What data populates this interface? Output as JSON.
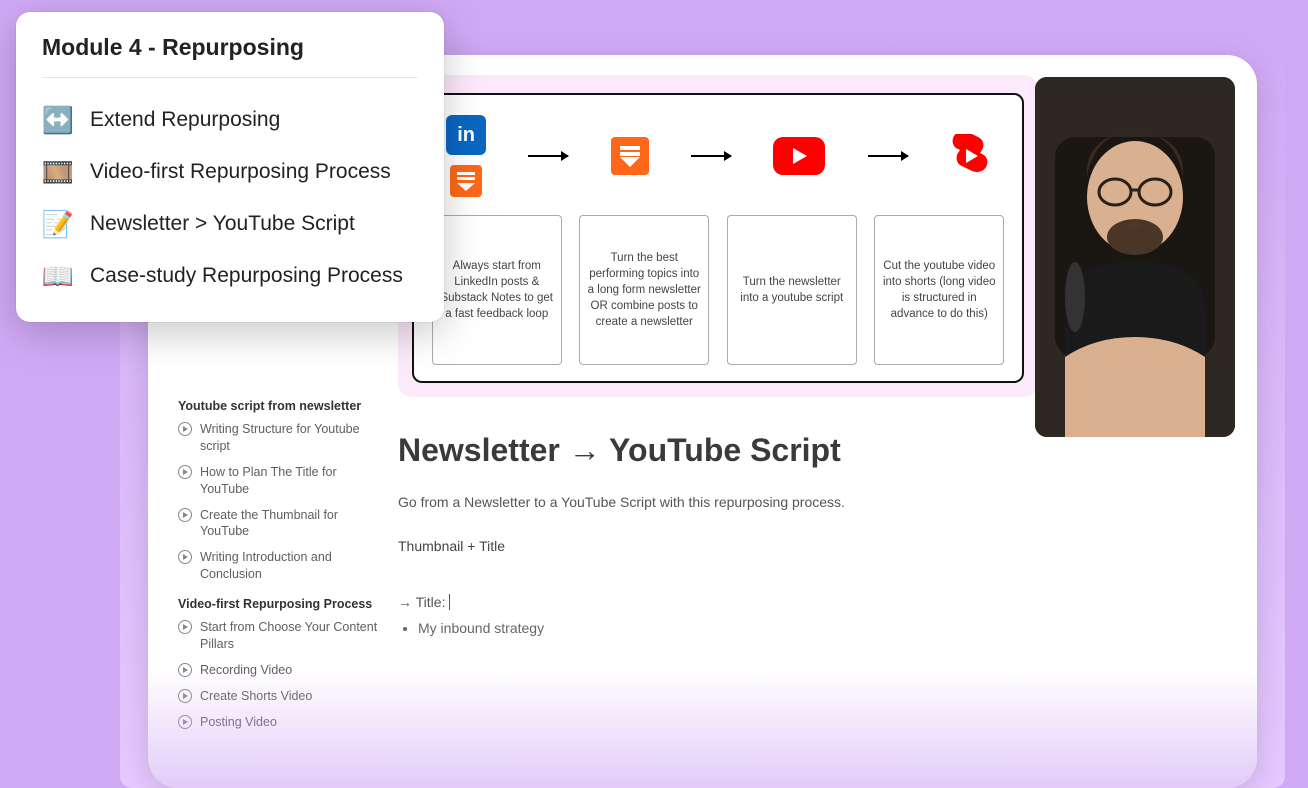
{
  "popup": {
    "title": "Module 4 - Repurposing",
    "items": [
      {
        "icon": "↔️",
        "label": "Extend Repurposing"
      },
      {
        "icon": "🎞️",
        "label": "Video-first Repurposing Process"
      },
      {
        "icon": "📝",
        "label": "Newsletter > YouTube Script"
      },
      {
        "icon": "📖",
        "label": "Case-study Repurposing Process"
      }
    ]
  },
  "sidebar": {
    "sections": [
      {
        "heading": "Youtube script from newsletter",
        "items": [
          "Writing Structure for Youtube script",
          "How to Plan The Title for YouTube",
          "Create the Thumbnail for YouTube",
          "Writing Introduction and Conclusion"
        ]
      },
      {
        "heading": "Video-first Repurposing Process",
        "items": [
          "Start from Choose Your Content Pillars",
          "Recording Video",
          "Create Shorts Video",
          "Posting Video"
        ]
      }
    ]
  },
  "diagram": {
    "steps": [
      "Always start from LinkedIn posts & Substack Notes to get a fast feedback loop",
      "Turn the best performing topics into a long form newsletter OR combine posts to create a newsletter",
      "Turn the newsletter into a youtube script",
      "Cut the youtube video into shorts (long video is structured in advance to do this)"
    ]
  },
  "doc": {
    "heading": "Newsletter → YouTube Script",
    "intro": "Go from a Newsletter to a YouTube Script with this repurposing process.",
    "section": "Thumbnail + Title",
    "title_prompt": "→ Title:",
    "bullet": "My inbound strategy"
  }
}
